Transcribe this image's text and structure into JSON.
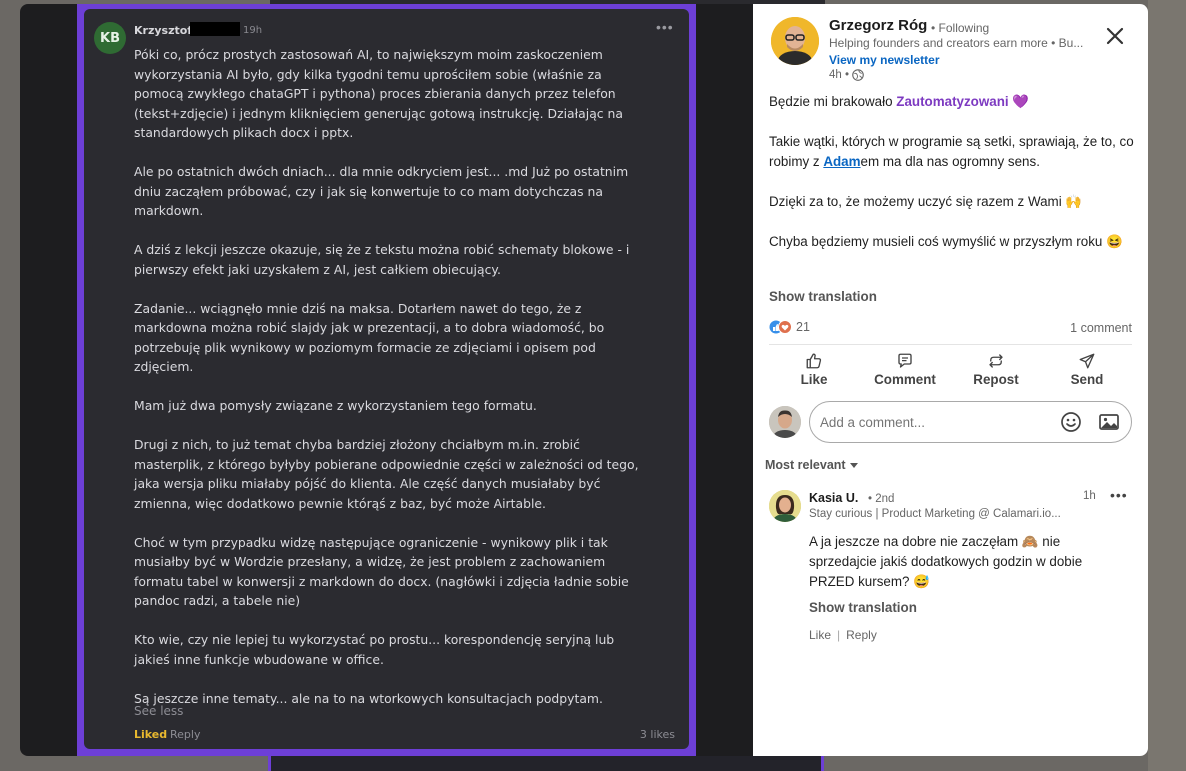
{
  "screenshot": {
    "author_initials": "KB",
    "author_name": "Krzysztof",
    "time": "19h",
    "paragraphs": [
      "Póki co, prócz prostych zastosowań AI, to największym moim zaskoczeniem wykorzystania AI było, gdy kilka tygodni temu uprościłem sobie (właśnie za pomocą zwykłego chataGPT i pythona) proces zbierania danych przez telefon (tekst+zdjęcie) i jednym kliknięciem generując gotową instrukcję. Działając na standardowych plikach docx i pptx.",
      "Ale po ostatnich dwóch dniach... dla mnie odkryciem jest... .md Już po ostatnim dniu zacząłem próbować, czy i jak się konwertuje to co mam dotychczas na markdown.",
      "A dziś z lekcji jeszcze okazuje, się że z tekstu można robić schematy blokowe - i pierwszy efekt jaki uzyskałem z AI, jest całkiem obiecujący.",
      "Zadanie... wciągnęło mnie dziś na maksa. Dotarłem nawet do tego, że z markdowna można robić slajdy jak w prezentacji, a to dobra wiadomość, bo potrzebuję plik wynikowy w poziomym formacie ze zdjęciami i opisem pod zdjęciem.",
      "Mam już dwa pomysły związane z wykorzystaniem tego formatu.",
      "Drugi z nich, to już temat chyba bardziej złożony chciałbym m.in. zrobić masterplik, z którego byłyby pobierane odpowiednie części w zależności od tego, jaka wersja pliku miałaby pójść do klienta. Ale część danych musiałaby być zmienna, więc dodatkowo pewnie którąś z baz, być może Airtable.",
      "Choć w tym przypadku widzę następujące ograniczenie - wynikowy plik i tak musiałby być w Wordzie przesłany, a widzę, że jest problem z zachowaniem formatu tabel w konwersji z markdown do docx. (nagłówki i zdjęcia ładnie sobie pandoc radzi, a tabele nie)",
      "Kto wie, czy nie lepiej tu wykorzystać po prostu... korespondencję seryjną lub jakieś inne funkcje wbudowane w office.",
      "Są jeszcze inne tematy... ale na to na wtorkowych konsultacjach podpytam."
    ],
    "see_less": "See less",
    "liked": "Liked",
    "reply": "Reply",
    "likes": "3 likes"
  },
  "post": {
    "author_name": "Grzegorz Róg",
    "following": "• Following",
    "headline": "Helping founders and creators earn more • Bu...",
    "newsletter": "View my newsletter",
    "time": "4h •",
    "p1_before": "Będzie mi brakowało ",
    "p1_hashtag": "Zautomatyzowani",
    "p1_after": " 💜",
    "p2_before": "Takie wątki, których w programie są setki, sprawiają, że to, co robimy z ",
    "p2_mention": "Adam",
    "p2_after": "em ma dla nas ogromny sens.",
    "p3": "Dzięki za to, że możemy uczyć się razem z Wami 🙌",
    "p4": "Chyba będziemy musieli coś wymyślić w przyszłym roku 😆",
    "show_translation": "Show translation",
    "reaction_count": "21",
    "comments_count": "1 comment"
  },
  "actions": {
    "like": "Like",
    "comment": "Comment",
    "repost": "Repost",
    "send": "Send"
  },
  "comment_box": {
    "placeholder": "Add a comment..."
  },
  "sort": {
    "label": "Most relevant"
  },
  "comment": {
    "name": "Kasia U.",
    "degree": "• 2nd",
    "time": "1h",
    "headline": "Stay curious | Product Marketing @ Calamari.io...",
    "text": "A ja jeszcze na dobre nie zaczęłam 🙈 nie sprzedajcie jakiś dodatkowych godzin w dobie PRZED kursem? 😅",
    "show_translation": "Show translation",
    "like": "Like",
    "reply": "Reply"
  },
  "colors": {
    "accent_purple": "#6d3fd6",
    "link_blue": "#0a66c2",
    "hashtag_purple": "#7d3ac1",
    "liked_gold": "#e9b92f"
  }
}
